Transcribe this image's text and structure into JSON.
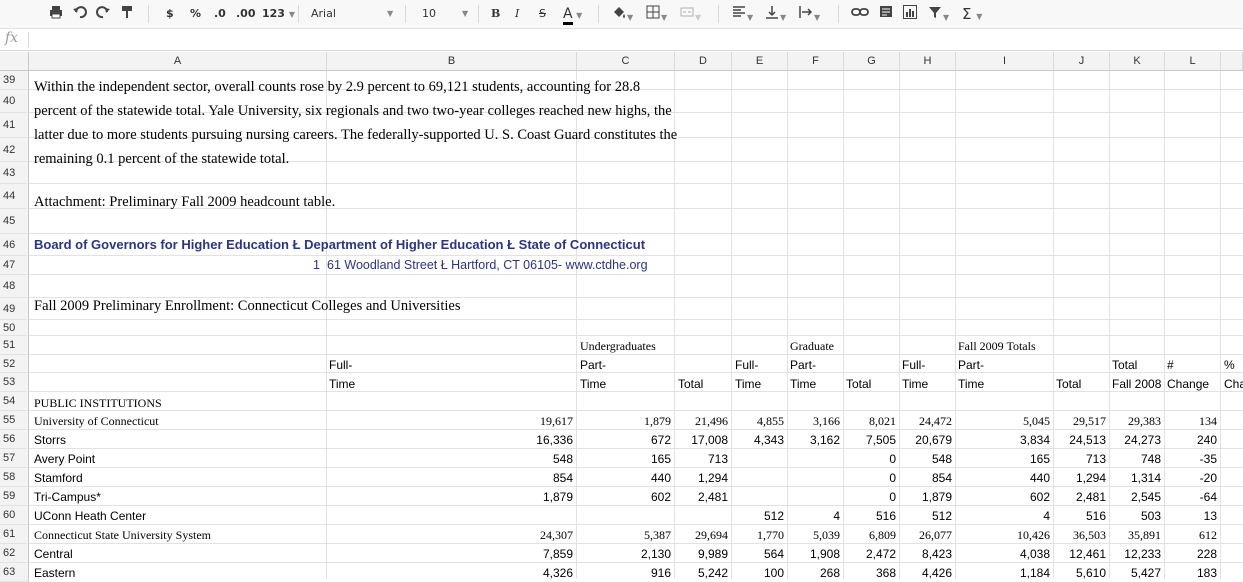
{
  "toolbar": {
    "currency": "$",
    "percent": "%",
    "dec_less": ".0",
    "dec_more": ".00",
    "more_formats": "123",
    "font": "Arial",
    "font_size": "10",
    "bold": "B",
    "italic": "I",
    "strike": "S",
    "text_color": "A",
    "sum": "Σ"
  },
  "formula_bar": {
    "fx": "fx",
    "value": ""
  },
  "columns": [
    "A",
    "B",
    "C",
    "D",
    "E",
    "F",
    "G",
    "H",
    "I",
    "J",
    "K",
    "L"
  ],
  "rows": [
    "39",
    "40",
    "41",
    "42",
    "43",
    "44",
    "45",
    "46",
    "47",
    "48",
    "49",
    "50",
    "51",
    "52",
    "53",
    "54",
    "55",
    "56",
    "57",
    "58",
    "59",
    "60",
    "61",
    "62",
    "63"
  ],
  "text": {
    "r39": "Within the independent sector, overall counts rose by 2.9 percent to 69,121 students, accounting for 28.8",
    "r40": "percent of the statewide total. Yale University, six regionals and two two-year colleges reached new highs, the",
    "r41": "latter due to more students pursuing nursing careers. The federally-supported U. S. Coast Guard constitutes the",
    "r42": "remaining 0.1 percent of the statewide total.",
    "r44": "Attachment:  Preliminary Fall 2009 headcount table.",
    "r46": "Board of Governors for Higher Education Ł Department of Higher Education Ł State of Connecticut",
    "r47a": "1",
    "r47b": "61 Woodland Street Ł Hartford, CT 06105- www.ctdhe.org",
    "r49": "Fall 2009 Preliminary Enrollment: Connecticut Colleges and Universities",
    "r51c": "Undergraduates",
    "r51f": "Graduate",
    "r51i": "Fall 2009 Totals",
    "r52b": "Full-",
    "r52c": "Part-",
    "r52e": "Full-",
    "r52f": "Part-",
    "r52h": "Full-",
    "r52i": "Part-",
    "r52k": "Total",
    "r52l": "#",
    "r52m": "%",
    "r53b": "Time",
    "r53c": "Time",
    "r53d": "Total",
    "r53e": "Time",
    "r53f": "Time",
    "r53g": "Total",
    "r53h": "Time",
    "r53i": "Time",
    "r53j": "Total",
    "r53k": "Fall 2008",
    "r53l": "Change",
    "r53m": "Cha",
    "r54": "PUBLIC INSTITUTIONS"
  },
  "table": [
    {
      "name": "University of Connecticut",
      "serif": true,
      "v": [
        "19,617",
        "1,879",
        "21,496",
        "4,855",
        "3,166",
        "8,021",
        "24,472",
        "5,045",
        "29,517",
        "29,383",
        "134"
      ]
    },
    {
      "name": "Storrs",
      "serif": false,
      "v": [
        "16,336",
        "672",
        "17,008",
        "4,343",
        "3,162",
        "7,505",
        "20,679",
        "3,834",
        "24,513",
        "24,273",
        "240"
      ]
    },
    {
      "name": "Avery Point",
      "serif": false,
      "v": [
        "548",
        "165",
        "713",
        "",
        "",
        "0",
        "548",
        "165",
        "713",
        "748",
        "-35"
      ]
    },
    {
      "name": "Stamford",
      "serif": false,
      "v": [
        "854",
        "440",
        "1,294",
        "",
        "",
        "0",
        "854",
        "440",
        "1,294",
        "1,314",
        "-20"
      ]
    },
    {
      "name": "Tri-Campus*",
      "serif": false,
      "v": [
        "1,879",
        "602",
        "2,481",
        "",
        "",
        "0",
        "1,879",
        "602",
        "2,481",
        "2,545",
        "-64"
      ]
    },
    {
      "name": "UConn Heath Center",
      "serif": false,
      "v": [
        "",
        "",
        "",
        "512",
        "4",
        "516",
        "512",
        "4",
        "516",
        "503",
        "13"
      ]
    },
    {
      "name": "Connecticut State University System",
      "serif": true,
      "v": [
        "24,307",
        "5,387",
        "29,694",
        "1,770",
        "5,039",
        "6,809",
        "26,077",
        "10,426",
        "36,503",
        "35,891",
        "612"
      ]
    },
    {
      "name": "Central",
      "serif": false,
      "v": [
        "7,859",
        "2,130",
        "9,989",
        "564",
        "1,908",
        "2,472",
        "8,423",
        "4,038",
        "12,461",
        "12,233",
        "228"
      ]
    },
    {
      "name": "Eastern",
      "serif": false,
      "v": [
        "4,326",
        "916",
        "5,242",
        "100",
        "268",
        "368",
        "4,426",
        "1,184",
        "5,610",
        "5,427",
        "183"
      ]
    }
  ]
}
